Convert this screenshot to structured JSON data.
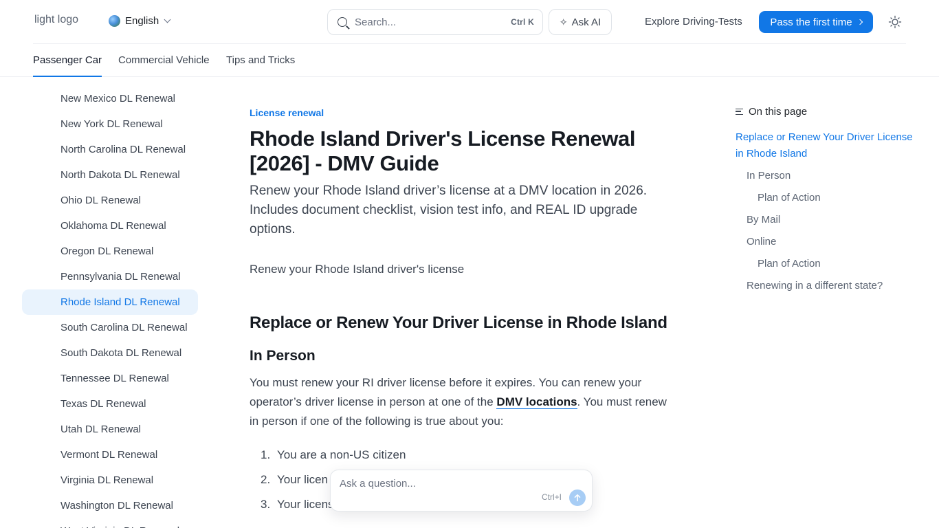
{
  "header": {
    "logo_alt": "light logo",
    "language": "English",
    "search_placeholder": "Search...",
    "search_shortcut": "Ctrl K",
    "ask_ai_label": "Ask AI",
    "explore_label": "Explore Driving-Tests",
    "cta_label": "Pass the first time"
  },
  "tabs": [
    {
      "label": "Passenger Car",
      "active": true
    },
    {
      "label": "Commercial Vehicle",
      "active": false
    },
    {
      "label": "Tips and Tricks",
      "active": false
    }
  ],
  "sidebar": {
    "items": [
      {
        "label": "New Mexico DL Renewal"
      },
      {
        "label": "New York DL Renewal"
      },
      {
        "label": "North Carolina DL Renewal"
      },
      {
        "label": "North Dakota DL Renewal"
      },
      {
        "label": "Ohio DL Renewal"
      },
      {
        "label": "Oklahoma DL Renewal"
      },
      {
        "label": "Oregon DL Renewal"
      },
      {
        "label": "Pennsylvania DL Renewal"
      },
      {
        "label": "Rhode Island DL Renewal",
        "active": true
      },
      {
        "label": "South Carolina DL Renewal"
      },
      {
        "label": "South Dakota DL Renewal"
      },
      {
        "label": "Tennessee DL Renewal"
      },
      {
        "label": "Texas DL Renewal"
      },
      {
        "label": "Utah DL Renewal"
      },
      {
        "label": "Vermont DL Renewal"
      },
      {
        "label": "Virginia DL Renewal"
      },
      {
        "label": "Washington DL Renewal"
      },
      {
        "label": "West Virginia DL Renewal"
      }
    ]
  },
  "article": {
    "eyebrow": "License renewal",
    "title": "Rhode Island Driver's License Renewal [2026] - DMV Guide",
    "lede": "Renew your Rhode Island driver’s license at a DMV location in 2026. Includes document checklist, vision test info, and REAL ID upgrade options.",
    "image_alt": "Renew your Rhode Island driver's license",
    "h2": "Replace or Renew Your Driver License in Rhode Island",
    "h3": "In Person",
    "para_before_link": "You must renew your RI driver license before it expires. You can renew your operator’s driver license in person at one of the ",
    "para_link": "DMV locations",
    "para_after_link": ". You must renew in person if one of the following is true about you:",
    "list": [
      {
        "num": "1.",
        "text": "You are a non-US citizen"
      },
      {
        "num": "2.",
        "text": "Your licen"
      },
      {
        "num": "3.",
        "text": "Your licens"
      }
    ]
  },
  "toc": {
    "heading": "On this page",
    "items": [
      {
        "label": "Replace or Renew Your Driver License in Rhode Island",
        "active": true
      },
      {
        "label": "In Person"
      },
      {
        "label": "Plan of Action"
      },
      {
        "label": "By Mail"
      },
      {
        "label": "Online"
      },
      {
        "label": "Plan of Action"
      },
      {
        "label": "Renewing in a different state?"
      }
    ]
  },
  "askbar": {
    "placeholder": "Ask a question...",
    "shortcut": "Ctrl+I"
  },
  "colors": {
    "accent": "#1177e6",
    "active_bg": "#e9f3fd"
  }
}
